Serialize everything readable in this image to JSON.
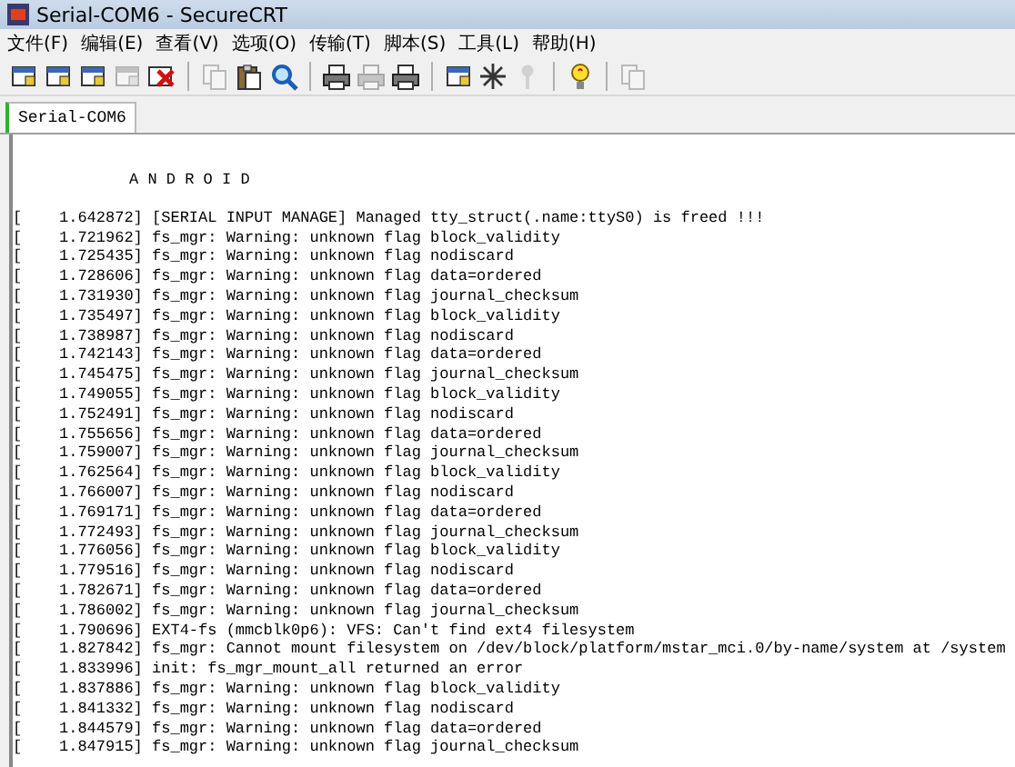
{
  "window": {
    "title": "Serial-COM6 - SecureCRT"
  },
  "menu": [
    "文件(F)",
    "编辑(E)",
    "查看(V)",
    "选项(O)",
    "传输(T)",
    "脚本(S)",
    "工具(L)",
    "帮助(H)"
  ],
  "toolbar": [
    {
      "kind": "window",
      "disabled": false
    },
    {
      "kind": "window",
      "disabled": false
    },
    {
      "kind": "window",
      "disabled": false
    },
    {
      "kind": "window",
      "disabled": true
    },
    {
      "kind": "cross",
      "disabled": false
    },
    {
      "kind": "sep"
    },
    {
      "kind": "pages",
      "disabled": true
    },
    {
      "kind": "clipboard",
      "disabled": false
    },
    {
      "kind": "magnifier",
      "disabled": false
    },
    {
      "kind": "sep"
    },
    {
      "kind": "printer",
      "disabled": false
    },
    {
      "kind": "printer",
      "disabled": true
    },
    {
      "kind": "printer",
      "disabled": false
    },
    {
      "kind": "sep"
    },
    {
      "kind": "window",
      "disabled": false
    },
    {
      "kind": "asterisk",
      "disabled": false
    },
    {
      "kind": "key",
      "disabled": true
    },
    {
      "kind": "sep"
    },
    {
      "kind": "bulb",
      "disabled": false
    },
    {
      "kind": "sep"
    },
    {
      "kind": "pages",
      "disabled": true
    }
  ],
  "tabs": [
    {
      "label": "Serial-COM6",
      "selected": true
    }
  ],
  "terminal": {
    "banner": "A N D R O I D",
    "lines": [
      "[    1.642872] [SERIAL INPUT MANAGE] Managed tty_struct(.name:ttyS0) is freed !!!",
      "[    1.721962] fs_mgr: Warning: unknown flag block_validity",
      "[    1.725435] fs_mgr: Warning: unknown flag nodiscard",
      "[    1.728606] fs_mgr: Warning: unknown flag data=ordered",
      "[    1.731930] fs_mgr: Warning: unknown flag journal_checksum",
      "[    1.735497] fs_mgr: Warning: unknown flag block_validity",
      "[    1.738987] fs_mgr: Warning: unknown flag nodiscard",
      "[    1.742143] fs_mgr: Warning: unknown flag data=ordered",
      "[    1.745475] fs_mgr: Warning: unknown flag journal_checksum",
      "[    1.749055] fs_mgr: Warning: unknown flag block_validity",
      "[    1.752491] fs_mgr: Warning: unknown flag nodiscard",
      "[    1.755656] fs_mgr: Warning: unknown flag data=ordered",
      "[    1.759007] fs_mgr: Warning: unknown flag journal_checksum",
      "[    1.762564] fs_mgr: Warning: unknown flag block_validity",
      "[    1.766007] fs_mgr: Warning: unknown flag nodiscard",
      "[    1.769171] fs_mgr: Warning: unknown flag data=ordered",
      "[    1.772493] fs_mgr: Warning: unknown flag journal_checksum",
      "[    1.776056] fs_mgr: Warning: unknown flag block_validity",
      "[    1.779516] fs_mgr: Warning: unknown flag nodiscard",
      "[    1.782671] fs_mgr: Warning: unknown flag data=ordered",
      "[    1.786002] fs_mgr: Warning: unknown flag journal_checksum",
      "[    1.790696] EXT4-fs (mmcblk0p6): VFS: Can't find ext4 filesystem",
      "[    1.827842] fs_mgr: Cannot mount filesystem on /dev/block/platform/mstar_mci.0/by-name/system at /system",
      "[    1.833996] init: fs_mgr_mount_all returned an error",
      "[    1.837886] fs_mgr: Warning: unknown flag block_validity",
      "[    1.841332] fs_mgr: Warning: unknown flag nodiscard",
      "[    1.844579] fs_mgr: Warning: unknown flag data=ordered",
      "[    1.847915] fs_mgr: Warning: unknown flag journal_checksum"
    ]
  }
}
